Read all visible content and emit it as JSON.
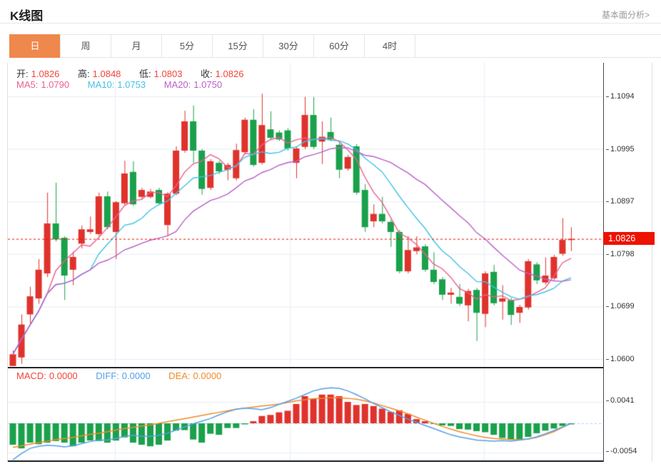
{
  "header": {
    "title": "K线图",
    "link": "基本面分析>"
  },
  "tabs": {
    "items": [
      "日",
      "周",
      "月",
      "5分",
      "15分",
      "30分",
      "60分",
      "4时"
    ],
    "active": "日",
    "active_color": "#ef884c"
  },
  "ohlc": {
    "open_label": "开:",
    "open": "1.0826",
    "high_label": "高:",
    "high": "1.0848",
    "low_label": "低:",
    "low": "1.0803",
    "close_label": "收:",
    "close": "1.0826"
  },
  "ma": {
    "ma5_label": "MA5:",
    "ma5": "1.0790",
    "ma10_label": "MA10:",
    "ma10": "1.0753",
    "ma20_label": "MA20:",
    "ma20": "1.0750"
  },
  "macd_info": {
    "macd_label": "MACD:",
    "macd": "0.0000",
    "diff_label": "DIFF:",
    "diff": "0.0000",
    "dea_label": "DEA:",
    "dea": "0.0000"
  },
  "colors": {
    "up": "#e0322c",
    "down": "#1aa14b",
    "ma5": "#ed5e8e",
    "ma10": "#3fc4e4",
    "ma20": "#bb5fc9",
    "diff": "#55a0e6",
    "dea": "#f08c2a",
    "current_price_line": "#f21000",
    "price_tag_bg": "#ee1200",
    "grid": "#e9eef5",
    "zero_dash": "#aad4f2"
  },
  "chart_data": [
    {
      "type": "candlestick",
      "title": "K线图 (日)",
      "y_axis_labels": [
        "1.1094",
        "1.0995",
        "1.0897",
        "1.0798",
        "1.0699",
        "1.0600"
      ],
      "y_range": [
        1.06,
        1.1094
      ],
      "last_price": 1.0826,
      "last_price_label": "1.0826",
      "legend": [
        "MA5",
        "MA10",
        "MA20"
      ],
      "candles_ohlc": [
        [
          1.0587,
          1.0616,
          1.0587,
          1.0609
        ],
        [
          1.0603,
          1.0684,
          1.0591,
          1.0665
        ],
        [
          1.0684,
          1.0736,
          1.0667,
          1.0718
        ],
        [
          1.0714,
          1.0788,
          1.0704,
          1.0768
        ],
        [
          1.0761,
          1.0913,
          1.0754,
          1.0855
        ],
        [
          1.0855,
          1.0932,
          1.0821,
          1.0825
        ],
        [
          1.0828,
          1.0831,
          1.0711,
          1.0757
        ],
        [
          1.0768,
          1.0802,
          1.0739,
          1.0792
        ],
        [
          1.0817,
          1.0851,
          1.0808,
          1.0844
        ],
        [
          1.0839,
          1.0868,
          1.0835,
          1.0844
        ],
        [
          1.0835,
          1.0913,
          1.0831,
          1.0906
        ],
        [
          1.0906,
          1.0915,
          1.0844,
          1.0848
        ],
        [
          1.0839,
          1.0897,
          1.0788,
          1.0895
        ],
        [
          1.0893,
          1.0973,
          1.089,
          1.0949
        ],
        [
          1.0952,
          1.0972,
          1.0888,
          1.0891
        ],
        [
          1.0905,
          1.0922,
          1.09,
          1.0918
        ],
        [
          1.0905,
          1.092,
          1.0902,
          1.0915
        ],
        [
          1.0918,
          1.0922,
          1.089,
          1.0893
        ],
        [
          1.0852,
          1.0914,
          1.0831,
          1.0911
        ],
        [
          1.0911,
          1.1,
          1.0908,
          1.0992
        ],
        [
          1.0992,
          1.1067,
          1.0988,
          1.1047
        ],
        [
          1.1047,
          1.1077,
          1.0969,
          1.0992
        ],
        [
          1.0992,
          1.0995,
          1.0909,
          1.092
        ],
        [
          1.0922,
          1.0976,
          1.0918,
          1.0972
        ],
        [
          1.0969,
          1.0973,
          1.0948,
          1.0953
        ],
        [
          1.0956,
          1.0969,
          1.0936,
          1.0965
        ],
        [
          1.094,
          1.1005,
          1.0936,
          1.0993
        ],
        [
          1.0989,
          1.1054,
          1.0985,
          1.105
        ],
        [
          1.105,
          1.107,
          1.0962,
          1.0965
        ],
        [
          1.0969,
          1.1099,
          1.0966,
          1.104
        ],
        [
          1.1032,
          1.1066,
          1.1012,
          1.1016
        ],
        [
          1.1026,
          1.103,
          1.101,
          1.1013
        ],
        [
          1.103,
          1.1034,
          1.0992,
          1.0996
        ],
        [
          1.0969,
          1.1,
          1.094,
          1.0996
        ],
        [
          1.0999,
          1.1093,
          1.0995,
          1.1059
        ],
        [
          1.1059,
          1.1093,
          1.0995,
          1.0999
        ],
        [
          1.1009,
          1.1047,
          1.0967,
          1.1018
        ],
        [
          1.1027,
          1.1054,
          1.101,
          1.1013
        ],
        [
          1.1003,
          1.1007,
          1.094,
          1.0956
        ],
        [
          1.0958,
          1.0984,
          1.0954,
          1.098
        ],
        [
          1.1,
          1.1004,
          1.0909,
          1.0913
        ],
        [
          1.0918,
          1.0929,
          1.0839,
          1.0848
        ],
        [
          1.0859,
          1.0891,
          1.0848,
          1.0873
        ],
        [
          1.0873,
          1.0905,
          1.0855,
          1.0859
        ],
        [
          1.0858,
          1.0862,
          1.0811,
          1.0839
        ],
        [
          1.0839,
          1.0843,
          1.0761,
          1.0765
        ],
        [
          1.0765,
          1.0831,
          1.0761,
          1.0805
        ],
        [
          1.0803,
          1.0831,
          1.0797,
          1.081
        ],
        [
          1.0812,
          1.0816,
          1.0764,
          1.0768
        ],
        [
          1.0768,
          1.0801,
          1.0741,
          1.0745
        ],
        [
          1.075,
          1.0754,
          1.0711,
          1.0721
        ],
        [
          1.0721,
          1.0734,
          1.0704,
          1.0725
        ],
        [
          1.0717,
          1.0741,
          1.07,
          1.0704
        ],
        [
          1.0701,
          1.0732,
          1.0671,
          1.0728
        ],
        [
          1.073,
          1.0734,
          1.0634,
          1.0687
        ],
        [
          1.0685,
          1.0765,
          1.066,
          1.0761
        ],
        [
          1.0764,
          1.0777,
          1.0701,
          1.0705
        ],
        [
          1.0708,
          1.0739,
          1.0674,
          1.0714
        ],
        [
          1.0711,
          1.0715,
          1.0664,
          1.0683
        ],
        [
          1.0687,
          1.0702,
          1.0668,
          1.0698
        ],
        [
          1.0697,
          1.0788,
          1.0693,
          1.0784
        ],
        [
          1.0778,
          1.0782,
          1.0741,
          1.0748
        ],
        [
          1.0744,
          1.0791,
          1.074,
          1.0757
        ],
        [
          1.0752,
          1.0796,
          1.0748,
          1.0792
        ],
        [
          1.0798,
          1.0865,
          1.0794,
          1.0824
        ],
        [
          1.0826,
          1.0848,
          1.0803,
          1.0826
        ]
      ],
      "ma_windows": [
        5,
        10,
        20
      ]
    },
    {
      "type": "bar",
      "title": "MACD",
      "y_axis_labels": [
        "0.0041",
        "-0.0054"
      ],
      "y_gridline_values": [
        0.0041,
        -0.0054
      ],
      "histogram": [
        -0.0041,
        -0.0048,
        -0.0037,
        -0.004,
        -0.0037,
        -0.0034,
        -0.0037,
        -0.0044,
        -0.0037,
        -0.0033,
        -0.0034,
        -0.0037,
        -0.0033,
        -0.0027,
        -0.0037,
        -0.0041,
        -0.0044,
        -0.0041,
        -0.0033,
        -0.0014,
        -0.0013,
        -0.0031,
        -0.0037,
        -0.002,
        -0.0022,
        -0.0009,
        -0.0009,
        -0.0002,
        0.0004,
        0.0014,
        0.0016,
        0.0021,
        0.0024,
        0.0037,
        0.0052,
        0.0047,
        0.0055,
        0.0055,
        0.0052,
        0.0041,
        0.0035,
        0.0037,
        0.0033,
        0.0028,
        0.0022,
        0.0025,
        0.0018,
        0.0008,
        0.0004,
        -0.0001,
        -0.0004,
        -0.0005,
        -0.0011,
        -0.0012,
        -0.0015,
        -0.0017,
        -0.0022,
        -0.0028,
        -0.0031,
        -0.0031,
        -0.0026,
        -0.0019,
        -0.0014,
        -0.001,
        -0.0005,
        -0.0002
      ],
      "diff_line": [
        -0.007,
        -0.0058,
        -0.0048,
        -0.0044,
        -0.0042,
        -0.0043,
        -0.0045,
        -0.0043,
        -0.0039,
        -0.0035,
        -0.0032,
        -0.0032,
        -0.0029,
        -0.0025,
        -0.0023,
        -0.0025,
        -0.0025,
        -0.0023,
        -0.0019,
        -0.0013,
        -0.0007,
        -0.0001,
        0.0004,
        0.0009,
        0.0016,
        0.0022,
        0.0027,
        0.0029,
        0.0028,
        0.0026,
        0.003,
        0.0036,
        0.0042,
        0.0048,
        0.0055,
        0.0062,
        0.0066,
        0.0068,
        0.0067,
        0.0062,
        0.0055,
        0.0047,
        0.0038,
        0.003,
        0.0022,
        0.0015,
        0.0008,
        0.0002,
        -0.0004,
        -0.001,
        -0.0016,
        -0.0022,
        -0.0026,
        -0.0029,
        -0.0032,
        -0.0033,
        -0.0034,
        -0.0033,
        -0.0034,
        -0.0032,
        -0.003,
        -0.0026,
        -0.002,
        -0.0014,
        -0.0007,
        0.0
      ],
      "dea_line": [
        -0.0046,
        -0.0043,
        -0.004,
        -0.0037,
        -0.0034,
        -0.0031,
        -0.0029,
        -0.0027,
        -0.0024,
        -0.0021,
        -0.0019,
        -0.0016,
        -0.0013,
        -0.001,
        -0.0008,
        -0.0005,
        -0.0003,
        0.0,
        0.0003,
        0.0006,
        0.0009,
        0.0012,
        0.0015,
        0.0018,
        0.0021,
        0.0024,
        0.0027,
        0.0029,
        0.0031,
        0.0033,
        0.0035,
        0.0037,
        0.004,
        0.0043,
        0.0045,
        0.0047,
        0.0048,
        0.0049,
        0.0049,
        0.0048,
        0.0046,
        0.0043,
        0.0039,
        0.0034,
        0.0029,
        0.0024,
        0.0018,
        0.0012,
        0.0006,
        0.0,
        -0.0006,
        -0.0011,
        -0.0016,
        -0.002,
        -0.0024,
        -0.0027,
        -0.0029,
        -0.003,
        -0.0031,
        -0.0031,
        -0.003,
        -0.0027,
        -0.0022,
        -0.0016,
        -0.0008,
        0.0
      ]
    }
  ]
}
